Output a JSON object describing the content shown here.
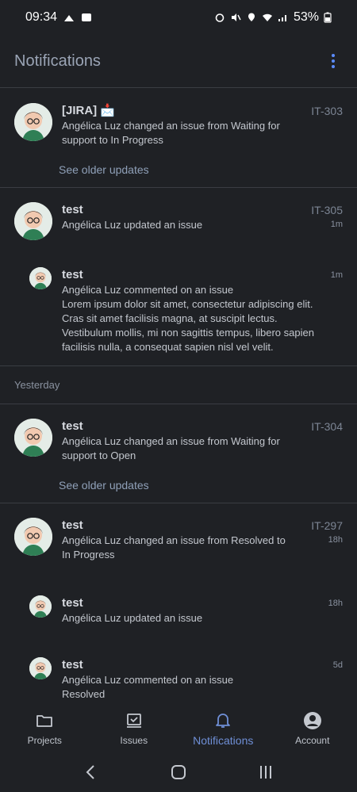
{
  "status_bar": {
    "time": "09:34",
    "battery": "53%"
  },
  "header": {
    "title": "Notifications"
  },
  "groups": [
    {
      "entries": [
        {
          "title": "[JIRA] 📩",
          "desc": "Angélica Luz changed an issue from Waiting for support to In Progress",
          "key": "IT-303",
          "time": ""
        }
      ],
      "older": "See older updates"
    },
    {
      "entries": [
        {
          "title": "test",
          "desc": "Angélica Luz updated an issue",
          "key": "IT-305",
          "time": "1m"
        },
        {
          "title": "test",
          "desc": "Angélica Luz commented on an issue",
          "comment": "Lorem ipsum dolor sit amet, consectetur adipiscing elit. Cras sit amet facilisis magna, at suscipit lectus. Vestibulum mollis, mi non sagittis tempus, libero sapien facilisis nulla, a consequat sapien nisl vel velit.",
          "key": "",
          "time": "1m"
        }
      ]
    },
    {
      "section": "Yesterday"
    },
    {
      "entries": [
        {
          "title": "test",
          "desc": "Angélica Luz changed an issue from Waiting for support to Open",
          "key": "IT-304",
          "time": ""
        }
      ],
      "older": "See older updates"
    },
    {
      "entries": [
        {
          "title": "test",
          "desc": "Angélica Luz changed an issue from Resolved to In Progress",
          "key": "IT-297",
          "time": "18h"
        },
        {
          "title": "test",
          "desc": "Angélica Luz updated an issue",
          "key": "",
          "time": "18h"
        },
        {
          "title": "test",
          "desc": "Angélica Luz commented on an issue",
          "comment": "Resolved",
          "key": "",
          "time": "5d"
        }
      ]
    }
  ],
  "bottom_nav": [
    {
      "label": "Projects",
      "icon": "folder-icon"
    },
    {
      "label": "Issues",
      "icon": "issues-icon"
    },
    {
      "label": "Notifications",
      "icon": "bell-icon",
      "active": true
    },
    {
      "label": "Account",
      "icon": "account-icon"
    }
  ],
  "colors": {
    "background": "#1f2125",
    "accent": "#6f8fd6",
    "kebab": "#5b8cff"
  }
}
